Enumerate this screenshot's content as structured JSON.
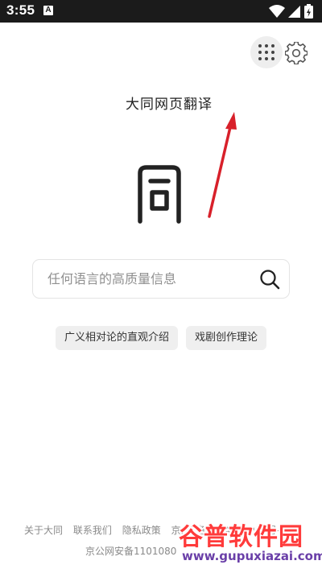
{
  "status_bar": {
    "time": "3:55",
    "notification_icon_letter": "A",
    "icons": [
      "wifi-icon",
      "signal-icon",
      "battery-charging-icon"
    ]
  },
  "header": {
    "apps_icon": "grid-dots-icon",
    "settings_icon": "gear-icon"
  },
  "app": {
    "title": "大同网页翻译",
    "logo_name": "datong-logo"
  },
  "search": {
    "placeholder": "任何语言的高质量信息",
    "value": ""
  },
  "suggestions": [
    "广义相对论的直观介绍",
    "戏剧创作理论"
  ],
  "footer": {
    "links": [
      "关于大同",
      "联系我们",
      "隐私政策",
      "京ICP备2024074994号-1"
    ],
    "icp_line": "京公网安备1101080"
  },
  "watermark": {
    "text": "谷普软件园",
    "url": "www.gupuxiazai.com"
  },
  "colors": {
    "annotation_arrow": "#d8202a",
    "status_bar_bg": "#1b1b1b",
    "chip_bg": "#efefef"
  }
}
